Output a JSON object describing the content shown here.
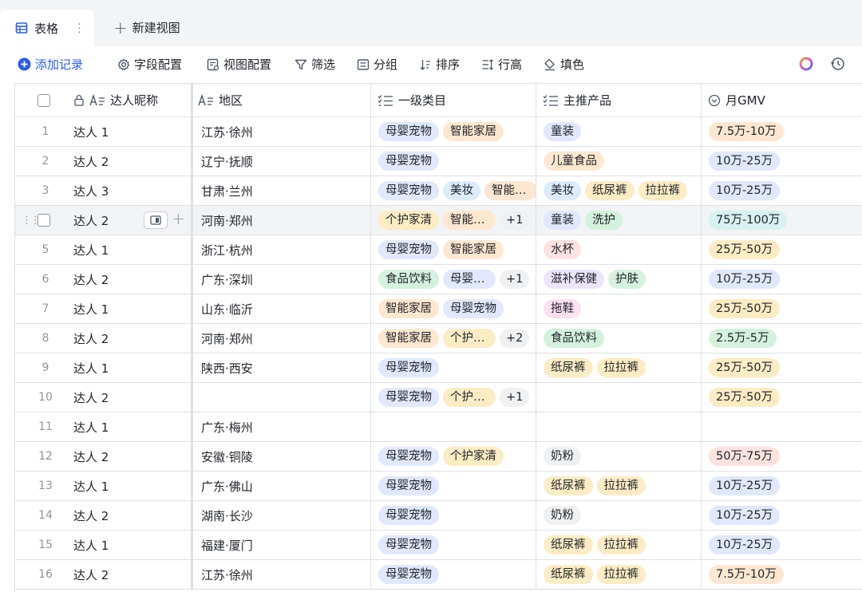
{
  "tabs": {
    "active_label": "表格",
    "new_view_label": "新建视图"
  },
  "toolbar": {
    "add_record": "添加记录",
    "field_config": "字段配置",
    "view_config": "视图配置",
    "filter": "筛选",
    "group": "分组",
    "sort": "排序",
    "row_height": "行高",
    "fill_color": "填色"
  },
  "columns": {
    "name": "达人昵称",
    "region": "地区",
    "category": "一级类目",
    "product": "主推产品",
    "gmv": "月GMV"
  },
  "tag_colors": {
    "母婴宠物": "#e1e8fd",
    "智能家居": "#fde7d0",
    "美妆": "#dcecfd",
    "个护家清": "#fcecc4",
    "食品饮料": "#d4f1de",
    "童装": "#e1e8fd",
    "儿童食品": "#fde7d0",
    "纸尿裤": "#fcecc4",
    "拉拉裤": "#fcecc4",
    "洗护": "#d4f1de",
    "水杯": "#fde2e0",
    "滋补保健": "#ebe4fb",
    "护肤": "#d4f1de",
    "拖鞋": "#fbe1f0",
    "奶粉": "#eff0f1",
    "7.5万-10万": "#fde7d0",
    "10万-25万": "#e1e8fd",
    "75万-100万": "#d6f1ef",
    "25万-50万": "#fcecc4",
    "2.5万-5万": "#d4f1de",
    "50万-75万": "#fde2e0"
  },
  "rows": [
    {
      "idx": "1",
      "name": "达人 1",
      "region": "江苏·徐州",
      "category": [
        "母婴宠物",
        "智能家居"
      ],
      "category_more": "",
      "product": [
        "童装"
      ],
      "gmv": "7.5万-10万"
    },
    {
      "idx": "2",
      "name": "达人 2",
      "region": "辽宁·抚顺",
      "category": [
        "母婴宠物"
      ],
      "category_more": "",
      "product": [
        "儿童食品"
      ],
      "gmv": "10万-25万"
    },
    {
      "idx": "3",
      "name": "达人 3",
      "region": "甘肃·兰州",
      "category": [
        "母婴宠物",
        "美妆",
        "智能家居"
      ],
      "category_more": "",
      "product": [
        "美妆",
        "纸尿裤",
        "拉拉裤"
      ],
      "gmv": "10万-25万"
    },
    {
      "idx": "4",
      "name": "达人 2",
      "region": "河南·郑州",
      "category": [
        "个护家清",
        "智能家居"
      ],
      "category_more": "+1",
      "product": [
        "童装",
        "洗护"
      ],
      "gmv": "75万-100万",
      "hover": true
    },
    {
      "idx": "5",
      "name": "达人 1",
      "region": "浙江·杭州",
      "category": [
        "母婴宠物",
        "智能家居"
      ],
      "category_more": "",
      "product": [
        "水杯"
      ],
      "gmv": "25万-50万"
    },
    {
      "idx": "6",
      "name": "达人 2",
      "region": "广东·深圳",
      "category": [
        "食品饮料",
        "母婴宠物"
      ],
      "category_more": "+1",
      "product": [
        "滋补保健",
        "护肤"
      ],
      "gmv": "10万-25万"
    },
    {
      "idx": "7",
      "name": "达人 1",
      "region": "山东·临沂",
      "category": [
        "智能家居",
        "母婴宠物"
      ],
      "category_more": "",
      "product": [
        "拖鞋"
      ],
      "gmv": "25万-50万"
    },
    {
      "idx": "8",
      "name": "达人 2",
      "region": "河南·郑州",
      "category": [
        "智能家居",
        "个护家清"
      ],
      "category_more": "+2",
      "product": [
        "食品饮料"
      ],
      "gmv": "2.5万-5万"
    },
    {
      "idx": "9",
      "name": "达人 1",
      "region": "陕西·西安",
      "category": [
        "母婴宠物"
      ],
      "category_more": "",
      "product": [
        "纸尿裤",
        "拉拉裤"
      ],
      "gmv": "25万-50万"
    },
    {
      "idx": "10",
      "name": "达人 2",
      "region": "",
      "category": [
        "母婴宠物",
        "个护家清"
      ],
      "category_more": "+1",
      "product": [],
      "gmv": "25万-50万"
    },
    {
      "idx": "11",
      "name": "达人 1",
      "region": "广东·梅州",
      "category": [],
      "category_more": "",
      "product": [],
      "gmv": ""
    },
    {
      "idx": "12",
      "name": "达人 2",
      "region": "安徽·铜陵",
      "category": [
        "母婴宠物",
        "个护家清"
      ],
      "category_more": "",
      "product": [
        "奶粉"
      ],
      "gmv": "50万-75万"
    },
    {
      "idx": "13",
      "name": "达人 1",
      "region": "广东·佛山",
      "category": [
        "母婴宠物"
      ],
      "category_more": "",
      "product": [
        "纸尿裤",
        "拉拉裤"
      ],
      "gmv": "10万-25万"
    },
    {
      "idx": "14",
      "name": "达人 2",
      "region": "湖南·长沙",
      "category": [
        "母婴宠物"
      ],
      "category_more": "",
      "product": [
        "奶粉"
      ],
      "gmv": "10万-25万"
    },
    {
      "idx": "15",
      "name": "达人 1",
      "region": "福建·厦门",
      "category": [
        "母婴宠物"
      ],
      "category_more": "",
      "product": [
        "纸尿裤",
        "拉拉裤"
      ],
      "gmv": "10万-25万"
    },
    {
      "idx": "16",
      "name": "达人 2",
      "region": "江苏·徐州",
      "category": [
        "母婴宠物"
      ],
      "category_more": "",
      "product": [
        "纸尿裤",
        "拉拉裤"
      ],
      "gmv": "7.5万-10万"
    }
  ]
}
